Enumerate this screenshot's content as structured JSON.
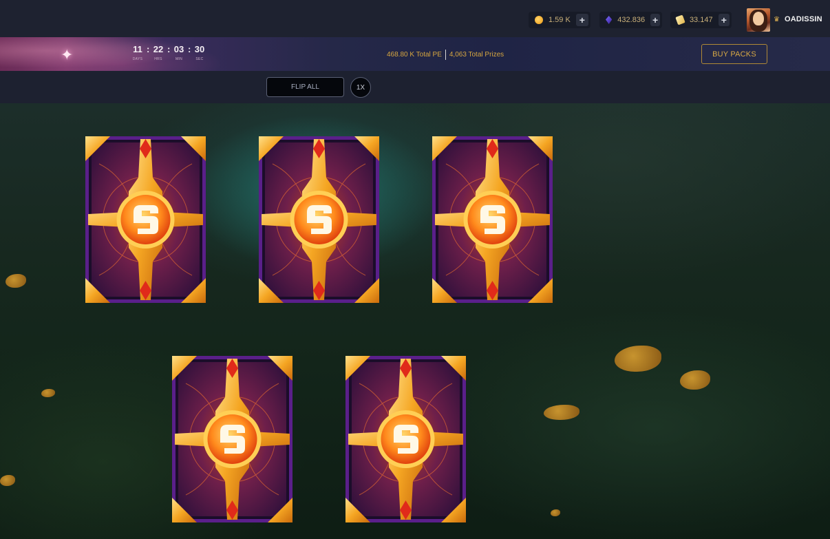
{
  "topbar": {
    "currencies": [
      {
        "icon": "coin-icon",
        "value": "1.59 K",
        "add_label": "+"
      },
      {
        "icon": "gem-icon",
        "value": "432.836",
        "add_label": "+"
      },
      {
        "icon": "ticket-icon",
        "value": "33.147",
        "add_label": "+"
      }
    ],
    "user": {
      "name": "OADISSIN",
      "rank_icon": "rank-badge-icon",
      "avatar_icon": "avatar"
    }
  },
  "banner": {
    "countdown": [
      {
        "value": "11",
        "label": "DAYS"
      },
      {
        "value": "22",
        "label": "HRS"
      },
      {
        "value": "03",
        "label": "MIN"
      },
      {
        "value": "30",
        "label": "SEC"
      }
    ],
    "separator": ":",
    "total_pe": "468.80 K Total PE",
    "total_prizes": "4,063 Total Prizes",
    "buy_packs_label": "BUY PACKS"
  },
  "controls": {
    "flip_all_label": "FLIP ALL",
    "speed_label": "1X"
  },
  "cards": [
    {
      "state": "face-down"
    },
    {
      "state": "face-down"
    },
    {
      "state": "face-down"
    },
    {
      "state": "face-down"
    },
    {
      "state": "face-down"
    }
  ],
  "colors": {
    "accent_gold": "#d7a845",
    "card_purple": "#5a1f8a",
    "card_orange": "#f5a623"
  }
}
